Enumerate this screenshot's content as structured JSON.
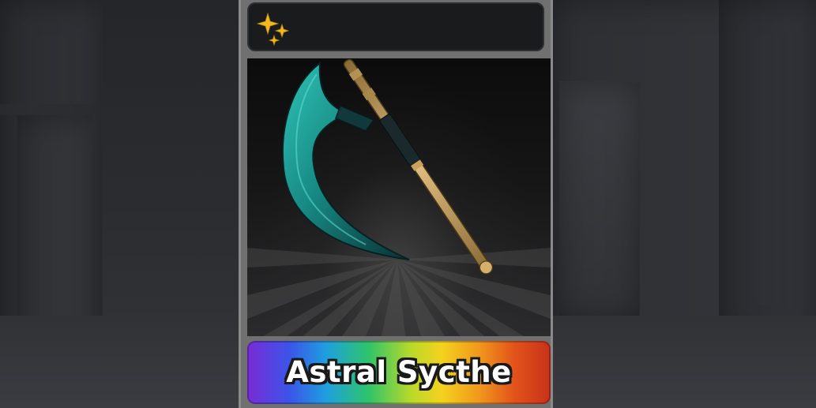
{
  "item_card": {
    "name": "Astral Sycthe",
    "rarity_icon": "sparkle-icon",
    "item_icon": "scythe-icon",
    "colors": {
      "card_frame": "#707070",
      "header_bg": "#1a1b1d",
      "sparkle": "#f2b81e",
      "blade": "#1fa39a",
      "handle": "#c9a15c",
      "banner_gradient": [
        "#7a2bd6",
        "#3b55e8",
        "#1f9fe0",
        "#2ec46a",
        "#f3d21e",
        "#f09a1c",
        "#c7321a"
      ]
    }
  }
}
